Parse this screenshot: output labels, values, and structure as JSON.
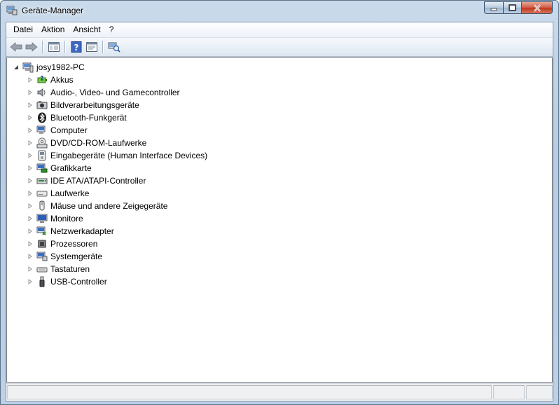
{
  "window": {
    "title": "Geräte-Manager"
  },
  "menubar": {
    "items": [
      "Datei",
      "Aktion",
      "Ansicht",
      "?"
    ]
  },
  "toolbar": {
    "buttons": [
      "back-icon",
      "forward-icon",
      "show-hide-console-tree-icon",
      "help-icon",
      "properties-icon",
      "scan-hardware-icon"
    ]
  },
  "tree": {
    "root": "josy1982-PC",
    "categories": [
      "Akkus",
      "Audio-, Video- und Gamecontroller",
      "Bildverarbeitungsgeräte",
      "Bluetooth-Funkgerät",
      "Computer",
      "DVD/CD-ROM-Laufwerke",
      "Eingabegeräte (Human Interface Devices)",
      "Grafikkarte",
      "IDE ATA/ATAPI-Controller",
      "Laufwerke",
      "Mäuse und andere Zeigegeräte",
      "Monitore",
      "Netzwerkadapter",
      "Prozessoren",
      "Systemgeräte",
      "Tastaturen",
      "USB-Controller"
    ]
  },
  "colors": {
    "titlebar": "#bcd0e6",
    "close": "#c1391c",
    "selection": "#3399ff"
  }
}
